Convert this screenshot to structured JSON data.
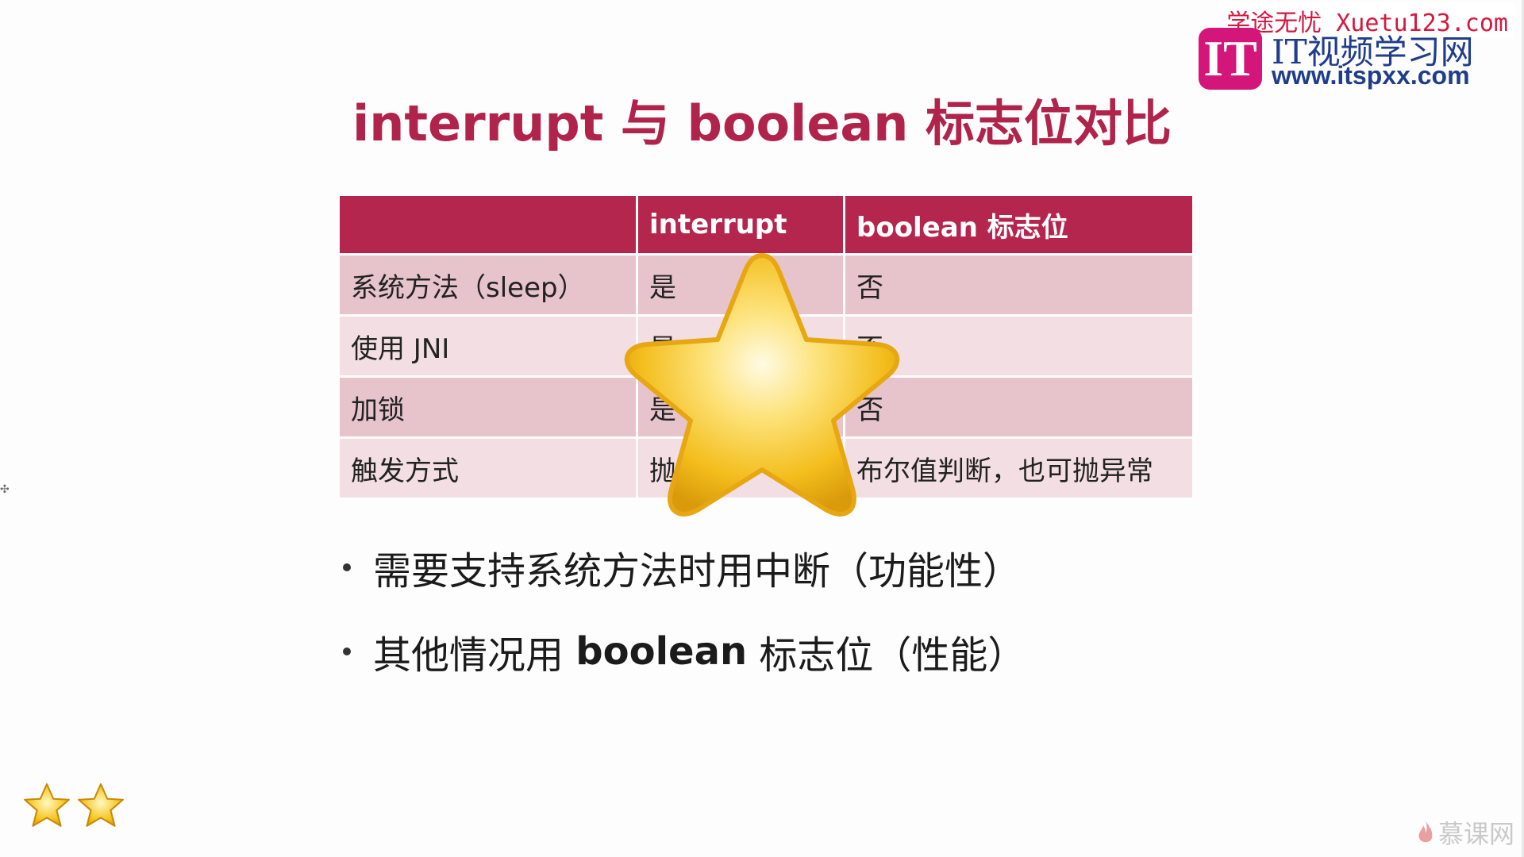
{
  "slide": {
    "title": "interrupt 与 boolean 标志位对比",
    "table": {
      "headers": [
        "",
        "interrupt",
        "boolean 标志位"
      ],
      "rows": [
        [
          "系统方法（sleep）",
          "是",
          "否"
        ],
        [
          "使用 JNI",
          "是",
          "否"
        ],
        [
          "加锁",
          "是",
          "否"
        ],
        [
          "触发方式",
          "抛",
          "布尔值判断，也可抛异常"
        ]
      ]
    },
    "bullets": [
      {
        "text": "需要支持系统方法时用中断（功能性）"
      },
      {
        "pre": "其他情况用 ",
        "bold": "boolean",
        "post": " 标志位（性能）"
      }
    ],
    "star_color": "#f5c518",
    "title_color": "#b0244b",
    "header_color": "#b5264e",
    "rating_stars": 2
  },
  "watermark": {
    "line1": "学途无忧 Xuetu123.com",
    "logo": "IT",
    "brand": "IT视频学习网",
    "url": "www.itspxx.com",
    "bottom": "慕课网"
  }
}
